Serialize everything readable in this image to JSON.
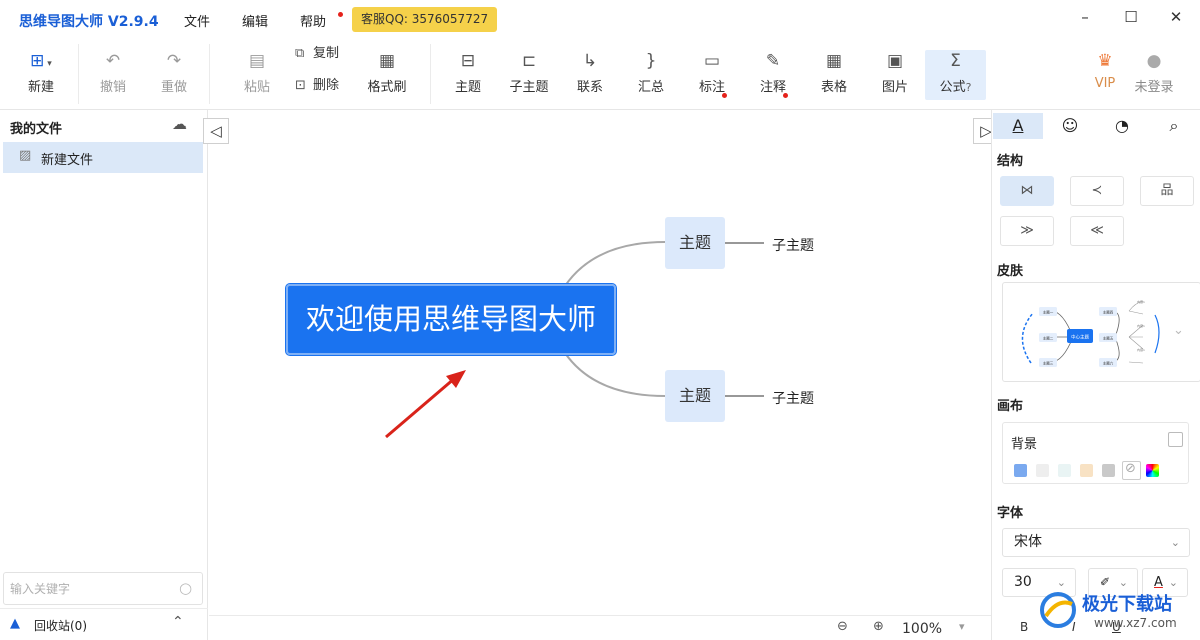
{
  "app": {
    "title": "思维导图大师 V2.9.4"
  },
  "menu": {
    "items": [
      "文件",
      "编辑",
      "帮助"
    ],
    "qq": "客服QQ: 3576057727"
  },
  "toolbar": {
    "new": "新建",
    "undo": "撤销",
    "redo": "重做",
    "paste": "粘贴",
    "copy": "复制",
    "delete": "删除",
    "format_painter": "格式刷",
    "topic": "主题",
    "subtopic": "子主题",
    "relation": "联系",
    "summary": "汇总",
    "marker": "标注",
    "note": "注释",
    "table": "表格",
    "image": "图片",
    "formula": "公式",
    "vip": "VIP",
    "login": "未登录"
  },
  "sidebar": {
    "title": "我的文件",
    "files": [
      "新建文件"
    ],
    "search_placeholder": "输入关键字",
    "recycle": "回收站(0)"
  },
  "mindmap": {
    "root": "欢迎使用思维导图大师",
    "topics": [
      {
        "label": "主题",
        "child": "子主题"
      },
      {
        "label": "主题",
        "child": "子主题"
      }
    ]
  },
  "status": {
    "zoom": "100%"
  },
  "props": {
    "structure": "结构",
    "skin": "皮肤",
    "canvas": "画布",
    "background": "背景",
    "font": "字体",
    "font_family": "宋体",
    "font_size": "30",
    "skin_preview": {
      "center": "中心主题",
      "left": [
        "主题一",
        "主题二",
        "主题三"
      ],
      "right": [
        "主题四",
        "主题五",
        "主题六"
      ],
      "leaf": "内容1"
    }
  },
  "swatch_colors": [
    "#7aa9ef",
    "#eeeeee",
    "#e9f4f4",
    "#f8e2c4",
    "#c9c9c9",
    "#ffffff"
  ],
  "accent_color": "#1a73f0",
  "watermark": {
    "name": "极光下载站",
    "url": "www.xz7.com"
  }
}
